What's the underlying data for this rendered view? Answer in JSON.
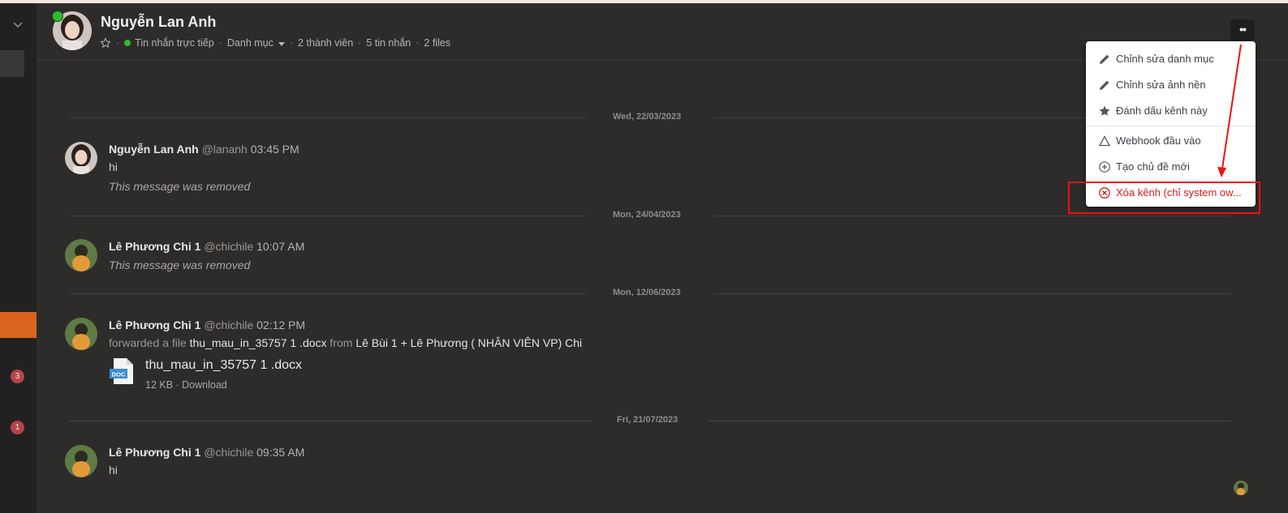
{
  "channel": {
    "name": "Nguyễn Lan Anh",
    "type_label": "Tin nhắn trực tiếp",
    "category_label": "Danh mục",
    "members": "2 thành viên",
    "messages": "5 tin nhắn",
    "files": "2 files",
    "menu_button": "••"
  },
  "rail": {
    "badges": [
      "3",
      "1"
    ]
  },
  "dates": [
    "Wed, 22/03/2023",
    "Mon, 24/04/2023",
    "Mon, 12/06/2023",
    "Fri, 21/07/2023"
  ],
  "messages": [
    {
      "name": "Nguyễn Lan Anh",
      "user": "@lananh",
      "time": "03:45 PM",
      "text": "hi",
      "removed": "This message was removed"
    },
    {
      "name": "Lê Phương Chi 1",
      "user": "@chichile",
      "time": "10:07 AM",
      "removed": "This message was removed"
    },
    {
      "name": "Lê Phương Chi 1",
      "user": "@chichile",
      "time": "02:12 PM",
      "forward_prefix": "forwarded a file",
      "forward_file": "thu_mau_in_35757 1 .docx",
      "forward_from_word": "from",
      "forward_from": "Lê Bùi 1 + Lê Phương ( NHÂN VIÊN VP) Chi",
      "file_name": "thu_mau_in_35757 1 .docx",
      "file_meta": "12 KB · Download",
      "file_badge": "DOC"
    },
    {
      "name": "Lê Phương Chi 1",
      "user": "@chichile",
      "time": "09:35 AM",
      "text": "hi"
    }
  ],
  "menu": {
    "items": [
      {
        "label": "Chỉnh sửa danh mục",
        "icon": "pencil-icon"
      },
      {
        "label": "Chỉnh sửa ảnh nền",
        "icon": "pencil-icon"
      },
      {
        "label": "Đánh dấu kênh này",
        "icon": "star-icon"
      },
      {
        "label": "Webhook đầu vào",
        "icon": "triangle-icon"
      },
      {
        "label": "Tạo chủ đề mới",
        "icon": "plus-circle-icon"
      },
      {
        "label": "Xóa kênh (chỉ system ow...",
        "icon": "x-circle-icon"
      }
    ]
  },
  "colors": {
    "accent": "#d8641e",
    "danger": "#d31d1d",
    "online": "#2fbb2f",
    "background": "#2e2c2b"
  }
}
